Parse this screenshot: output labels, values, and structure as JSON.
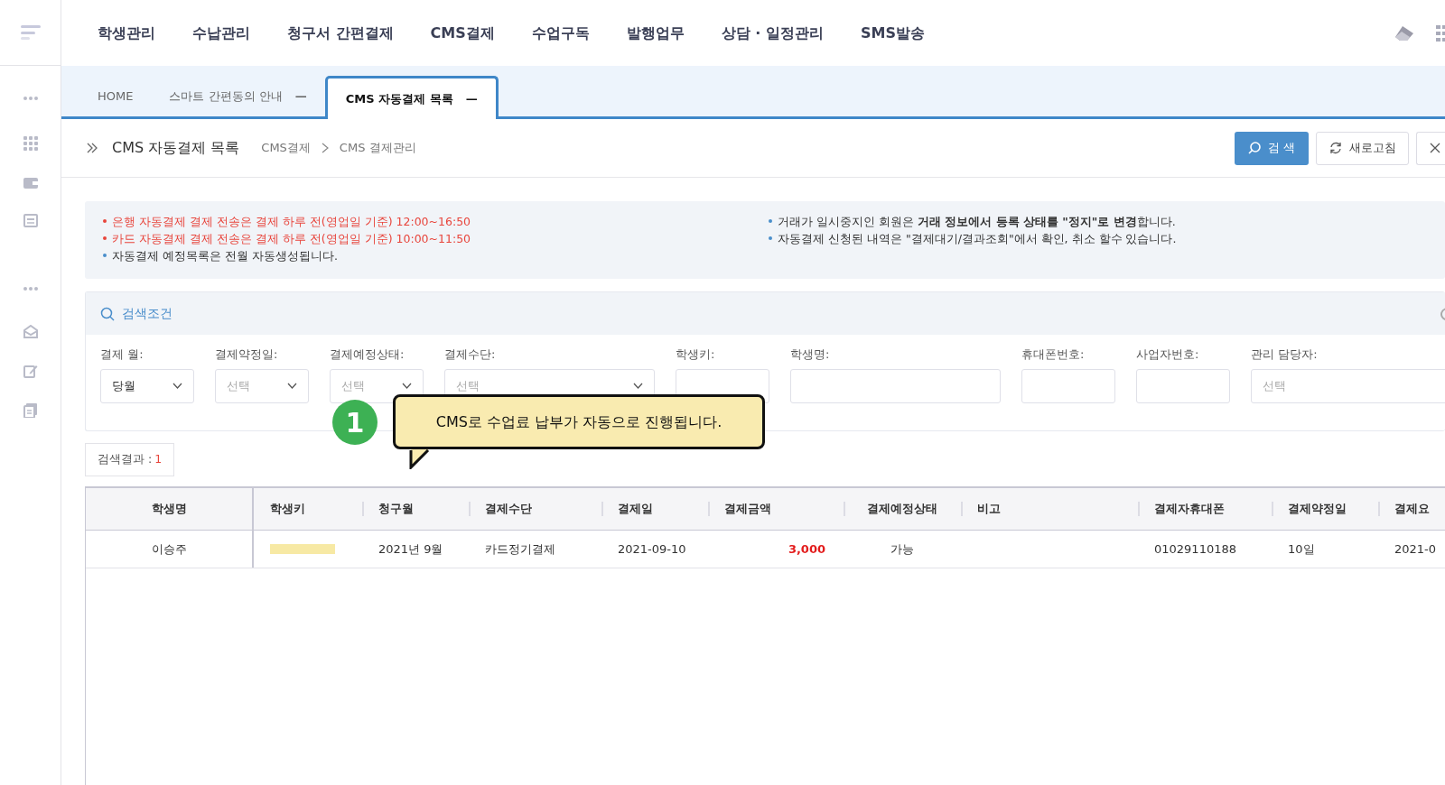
{
  "top_menu": [
    {
      "label": "학생관리"
    },
    {
      "label": "수납관리"
    },
    {
      "label": "청구서 간편결제"
    },
    {
      "label": "CMS결제"
    },
    {
      "label": "수업구독"
    },
    {
      "label": "발행업무"
    },
    {
      "label": "상담 · 일정관리"
    },
    {
      "label": "SMS발송"
    }
  ],
  "tabs": [
    {
      "label": "HOME",
      "selected": false,
      "closable": false
    },
    {
      "label": "스마트 간편동의 안내",
      "selected": false,
      "closable": true,
      "close_glyph": "—"
    },
    {
      "label": "CMS 자동결제 목록",
      "selected": true,
      "closable": true,
      "close_glyph": "—"
    }
  ],
  "page_header": {
    "title": "CMS 자동결제 목록",
    "breadcrumb": [
      "CMS결제",
      "CMS 결제관리"
    ],
    "search_button": "검 색",
    "refresh_button": "새로고침"
  },
  "notices_left": [
    {
      "kind": "warning",
      "text": "은행 자동결제 결제 전송은 결제 하루 전(영업일 기준) 12:00~16:50"
    },
    {
      "kind": "warning",
      "text": "카드 자동결제 결제 전송은 결제 하루 전(영업일 기준) 10:00~11:50"
    },
    {
      "kind": "info",
      "text": "자동결제 예정목록은 전월 자동생성됩니다."
    }
  ],
  "notices_right": [
    {
      "kind": "info",
      "text": "거래가 일시중지인 회원은 **거래 정보에서 등록 상태를 \"정지\"로 변경**합니다."
    },
    {
      "kind": "info",
      "text": "자동결제 신청된 내역은 \"결제대기/결과조회\"에서 확인, 취소 할수 있습니다."
    }
  ],
  "search_panel": {
    "title": "검색조건",
    "filters": [
      {
        "label": "결제 월:",
        "kind": "select",
        "value": "당월"
      },
      {
        "label": "결제약정일:",
        "kind": "select",
        "placeholder": "선택"
      },
      {
        "label": "결제예정상태:",
        "kind": "select",
        "placeholder": "선택"
      },
      {
        "label": "결제수단:",
        "kind": "select",
        "placeholder": "선택",
        "wide": true
      },
      {
        "label": "학생키:",
        "kind": "text"
      },
      {
        "label": "학생명:",
        "kind": "text",
        "wide": true
      },
      {
        "label": "휴대폰번호:",
        "kind": "text"
      },
      {
        "label": "사업자번호:",
        "kind": "text"
      },
      {
        "label": "관리 담당자:",
        "kind": "text",
        "placeholder": "선택",
        "wide": true
      }
    ]
  },
  "result_count": {
    "label": "검색결과 :",
    "count": "1"
  },
  "callout": {
    "number": "1",
    "text": "CMS로 수업료 납부가 자동으로 진행됩니다."
  },
  "table": {
    "columns": [
      "학생명",
      "학생키",
      "청구월",
      "결제수단",
      "결제일",
      "결제금액",
      "결제예정상태",
      "비고",
      "결제자휴대폰",
      "결제약정일",
      "결제요"
    ],
    "rows": [
      {
        "cells": [
          "이승주",
          "",
          "2021년 9월",
          "카드정기결제",
          "2021-09-10",
          "3,000",
          "가능",
          "",
          "01029110188",
          "10일",
          "2021-0"
        ]
      }
    ]
  }
}
